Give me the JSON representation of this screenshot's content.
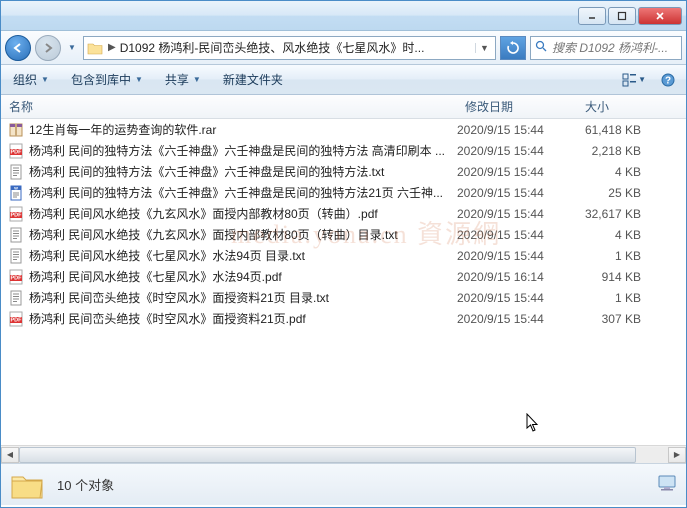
{
  "titlebar": {
    "min_label": "Minimize",
    "max_label": "Maximize",
    "close_label": "Close"
  },
  "navbar": {
    "address_prefix": "▶",
    "address_text": "D1092 杨鸿利-民间峦头绝技、风水绝技《七星风水》时...",
    "search_placeholder": "搜索 D1092 杨鸿利-..."
  },
  "toolbar": {
    "organize": "组织",
    "include": "包含到库中",
    "share": "共享",
    "newfolder": "新建文件夹"
  },
  "columns": {
    "name": "名称",
    "date": "修改日期",
    "size": "大小"
  },
  "files": [
    {
      "icon": "rar",
      "name": "12生肖每一年的运势查询的软件.rar",
      "date": "2020/9/15 15:44",
      "size": "61,418 KB"
    },
    {
      "icon": "pdf",
      "name": "杨鸿利  民间的独特方法《六壬神盘》六壬神盘是民间的独特方法 高清印刷本 ...",
      "date": "2020/9/15 15:44",
      "size": "2,218 KB"
    },
    {
      "icon": "txt",
      "name": "杨鸿利  民间的独特方法《六壬神盘》六壬神盘是民间的独特方法.txt",
      "date": "2020/9/15 15:44",
      "size": "4 KB"
    },
    {
      "icon": "doc",
      "name": "杨鸿利  民间的独特方法《六壬神盘》六壬神盘是民间的独特方法21页  六壬神...",
      "date": "2020/9/15 15:44",
      "size": "25 KB"
    },
    {
      "icon": "pdf",
      "name": "杨鸿利 民间风水绝技《九玄风水》面授内部教材80页（转曲）.pdf",
      "date": "2020/9/15 15:44",
      "size": "32,617 KB"
    },
    {
      "icon": "txt",
      "name": "杨鸿利 民间风水绝技《九玄风水》面授内部教材80页（转曲）目录.txt",
      "date": "2020/9/15 15:44",
      "size": "4 KB"
    },
    {
      "icon": "txt",
      "name": "杨鸿利 民间风水绝技《七星风水》水法94页  目录.txt",
      "date": "2020/9/15 15:44",
      "size": "1 KB"
    },
    {
      "icon": "pdf",
      "name": "杨鸿利 民间风水绝技《七星风水》水法94页.pdf",
      "date": "2020/9/15 16:14",
      "size": "914 KB"
    },
    {
      "icon": "txt",
      "name": "杨鸿利 民间峦头绝技《时空风水》面授资料21页  目录.txt",
      "date": "2020/9/15 15:44",
      "size": "1 KB"
    },
    {
      "icon": "pdf",
      "name": "杨鸿利 民间峦头绝技《时空风水》面授资料21页.pdf",
      "date": "2020/9/15 15:44",
      "size": "307 KB"
    }
  ],
  "status": {
    "count_text": "10 个对象"
  },
  "watermark": "media.yona.cn 資源網"
}
